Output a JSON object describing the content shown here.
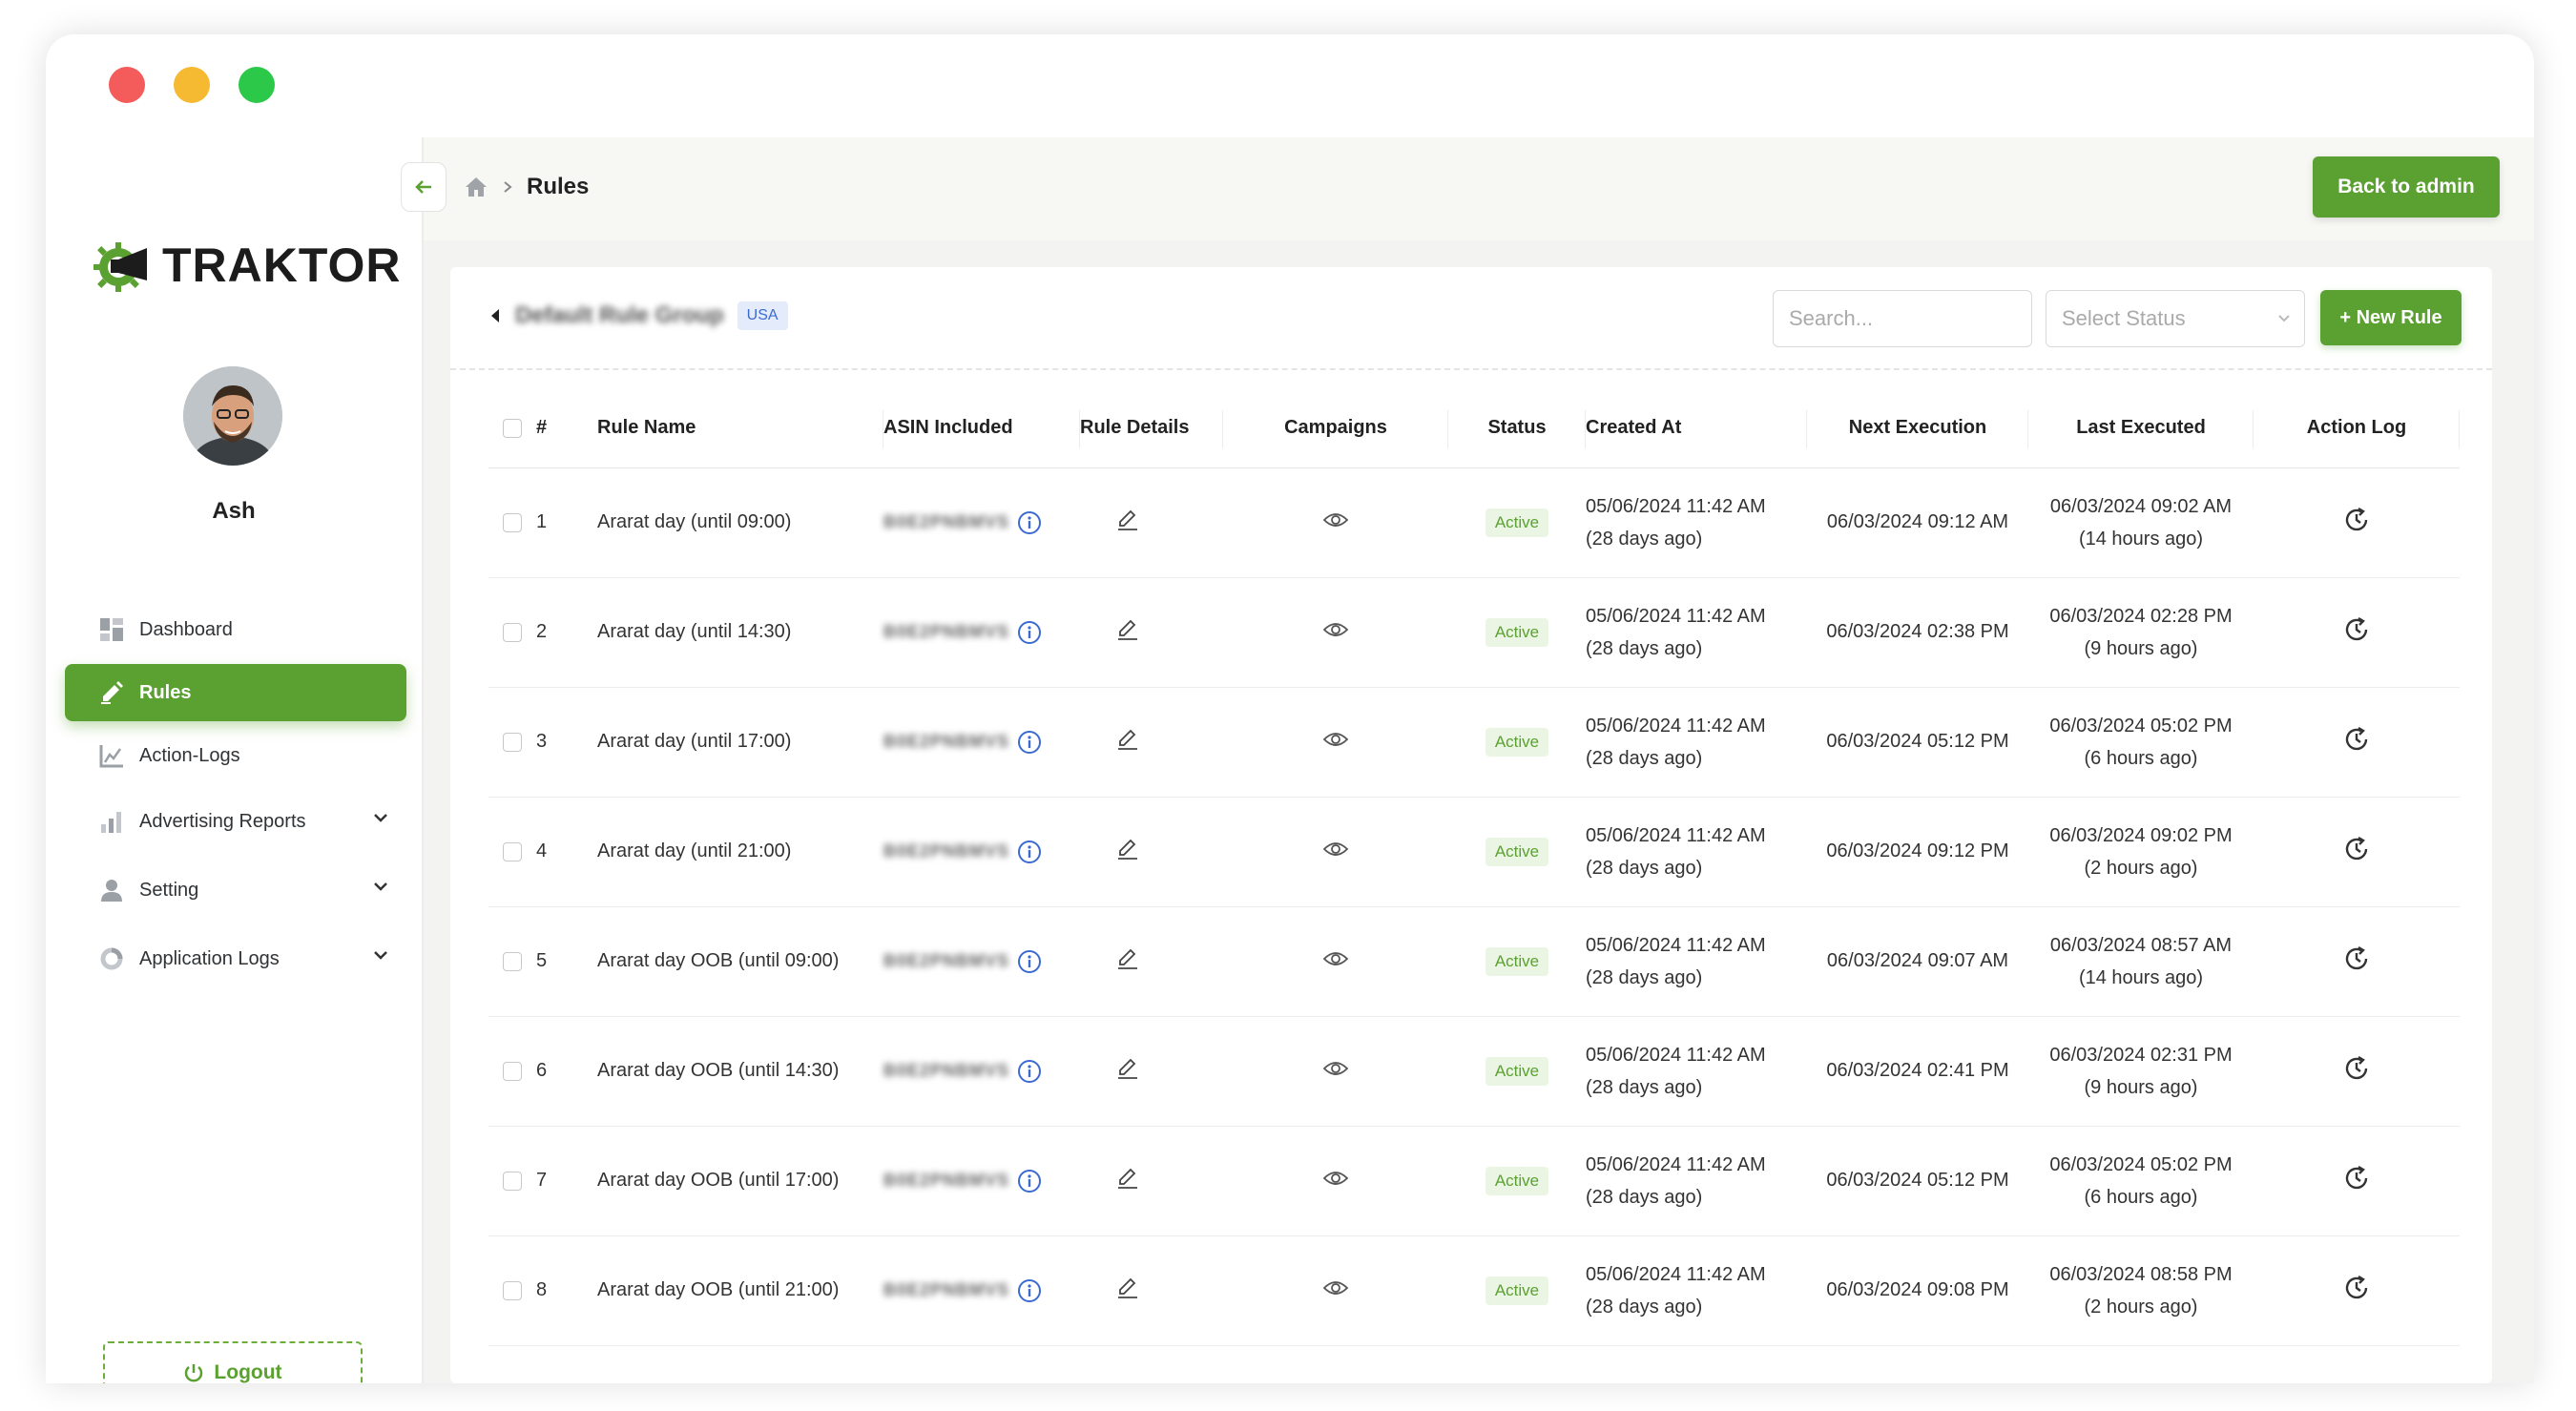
{
  "app": {
    "brand": "TRAKTOR",
    "user_name": "Ash",
    "accent_color": "#5ba131"
  },
  "sidebar": {
    "items": [
      {
        "label": "Dashboard",
        "icon": "dashboard-icon",
        "active": false,
        "has_children": false
      },
      {
        "label": "Rules",
        "icon": "rules-icon",
        "active": true,
        "has_children": false
      },
      {
        "label": "Action-Logs",
        "icon": "action-logs-icon",
        "active": false,
        "has_children": false
      },
      {
        "label": "Advertising Reports",
        "icon": "bar-chart-icon",
        "active": false,
        "has_children": true
      },
      {
        "label": "Setting",
        "icon": "user-icon",
        "active": false,
        "has_children": true
      },
      {
        "label": "Application Logs",
        "icon": "donut-chart-icon",
        "active": false,
        "has_children": true
      }
    ],
    "logout_label": "Logout"
  },
  "topbar": {
    "breadcrumb_current": "Rules",
    "back_admin_label": "Back to admin"
  },
  "rule_group": {
    "name": "Default Rule Group",
    "marketplace": "USA",
    "search_placeholder": "Search...",
    "status_placeholder": "Select Status",
    "new_rule_label": "+ New Rule"
  },
  "table": {
    "columns": [
      "#",
      "Rule Name",
      "ASIN Included",
      "Rule Details",
      "Campaigns",
      "Status",
      "Created At",
      "Next Execution",
      "Last Executed",
      "Action Log"
    ],
    "rows": [
      {
        "num": "1",
        "name": "Ararat day (until 09:00)",
        "asin": "B0E2PNBMVS",
        "status": "Active",
        "created": "05/06/2024 11:42 AM",
        "created_rel": "(28 days ago)",
        "next": "06/03/2024 09:12 AM",
        "last": "06/03/2024 09:02 AM",
        "last_rel": "(14 hours ago)"
      },
      {
        "num": "2",
        "name": "Ararat day (until 14:30)",
        "asin": "B0E2PNBMVS",
        "status": "Active",
        "created": "05/06/2024 11:42 AM",
        "created_rel": "(28 days ago)",
        "next": "06/03/2024 02:38 PM",
        "last": "06/03/2024 02:28 PM",
        "last_rel": "(9 hours ago)"
      },
      {
        "num": "3",
        "name": "Ararat day (until 17:00)",
        "asin": "B0E2PNBMVS",
        "status": "Active",
        "created": "05/06/2024 11:42 AM",
        "created_rel": "(28 days ago)",
        "next": "06/03/2024 05:12 PM",
        "last": "06/03/2024 05:02 PM",
        "last_rel": "(6 hours ago)"
      },
      {
        "num": "4",
        "name": "Ararat day (until 21:00)",
        "asin": "B0E2PNBMVS",
        "status": "Active",
        "created": "05/06/2024 11:42 AM",
        "created_rel": "(28 days ago)",
        "next": "06/03/2024 09:12 PM",
        "last": "06/03/2024 09:02 PM",
        "last_rel": "(2 hours ago)"
      },
      {
        "num": "5",
        "name": "Ararat day OOB (until 09:00)",
        "asin": "B0E2PNBMVS",
        "status": "Active",
        "created": "05/06/2024 11:42 AM",
        "created_rel": "(28 days ago)",
        "next": "06/03/2024 09:07 AM",
        "last": "06/03/2024 08:57 AM",
        "last_rel": "(14 hours ago)"
      },
      {
        "num": "6",
        "name": "Ararat day OOB (until 14:30)",
        "asin": "B0E2PNBMVS",
        "status": "Active",
        "created": "05/06/2024 11:42 AM",
        "created_rel": "(28 days ago)",
        "next": "06/03/2024 02:41 PM",
        "last": "06/03/2024 02:31 PM",
        "last_rel": "(9 hours ago)"
      },
      {
        "num": "7",
        "name": "Ararat day OOB (until 17:00)",
        "asin": "B0E2PNBMVS",
        "status": "Active",
        "created": "05/06/2024 11:42 AM",
        "created_rel": "(28 days ago)",
        "next": "06/03/2024 05:12 PM",
        "last": "06/03/2024 05:02 PM",
        "last_rel": "(6 hours ago)"
      },
      {
        "num": "8",
        "name": "Ararat day OOB (until 21:00)",
        "asin": "B0E2PNBMVS",
        "status": "Active",
        "created": "05/06/2024 11:42 AM",
        "created_rel": "(28 days ago)",
        "next": "06/03/2024 09:08 PM",
        "last": "06/03/2024 08:58 PM",
        "last_rel": "(2 hours ago)"
      }
    ]
  }
}
